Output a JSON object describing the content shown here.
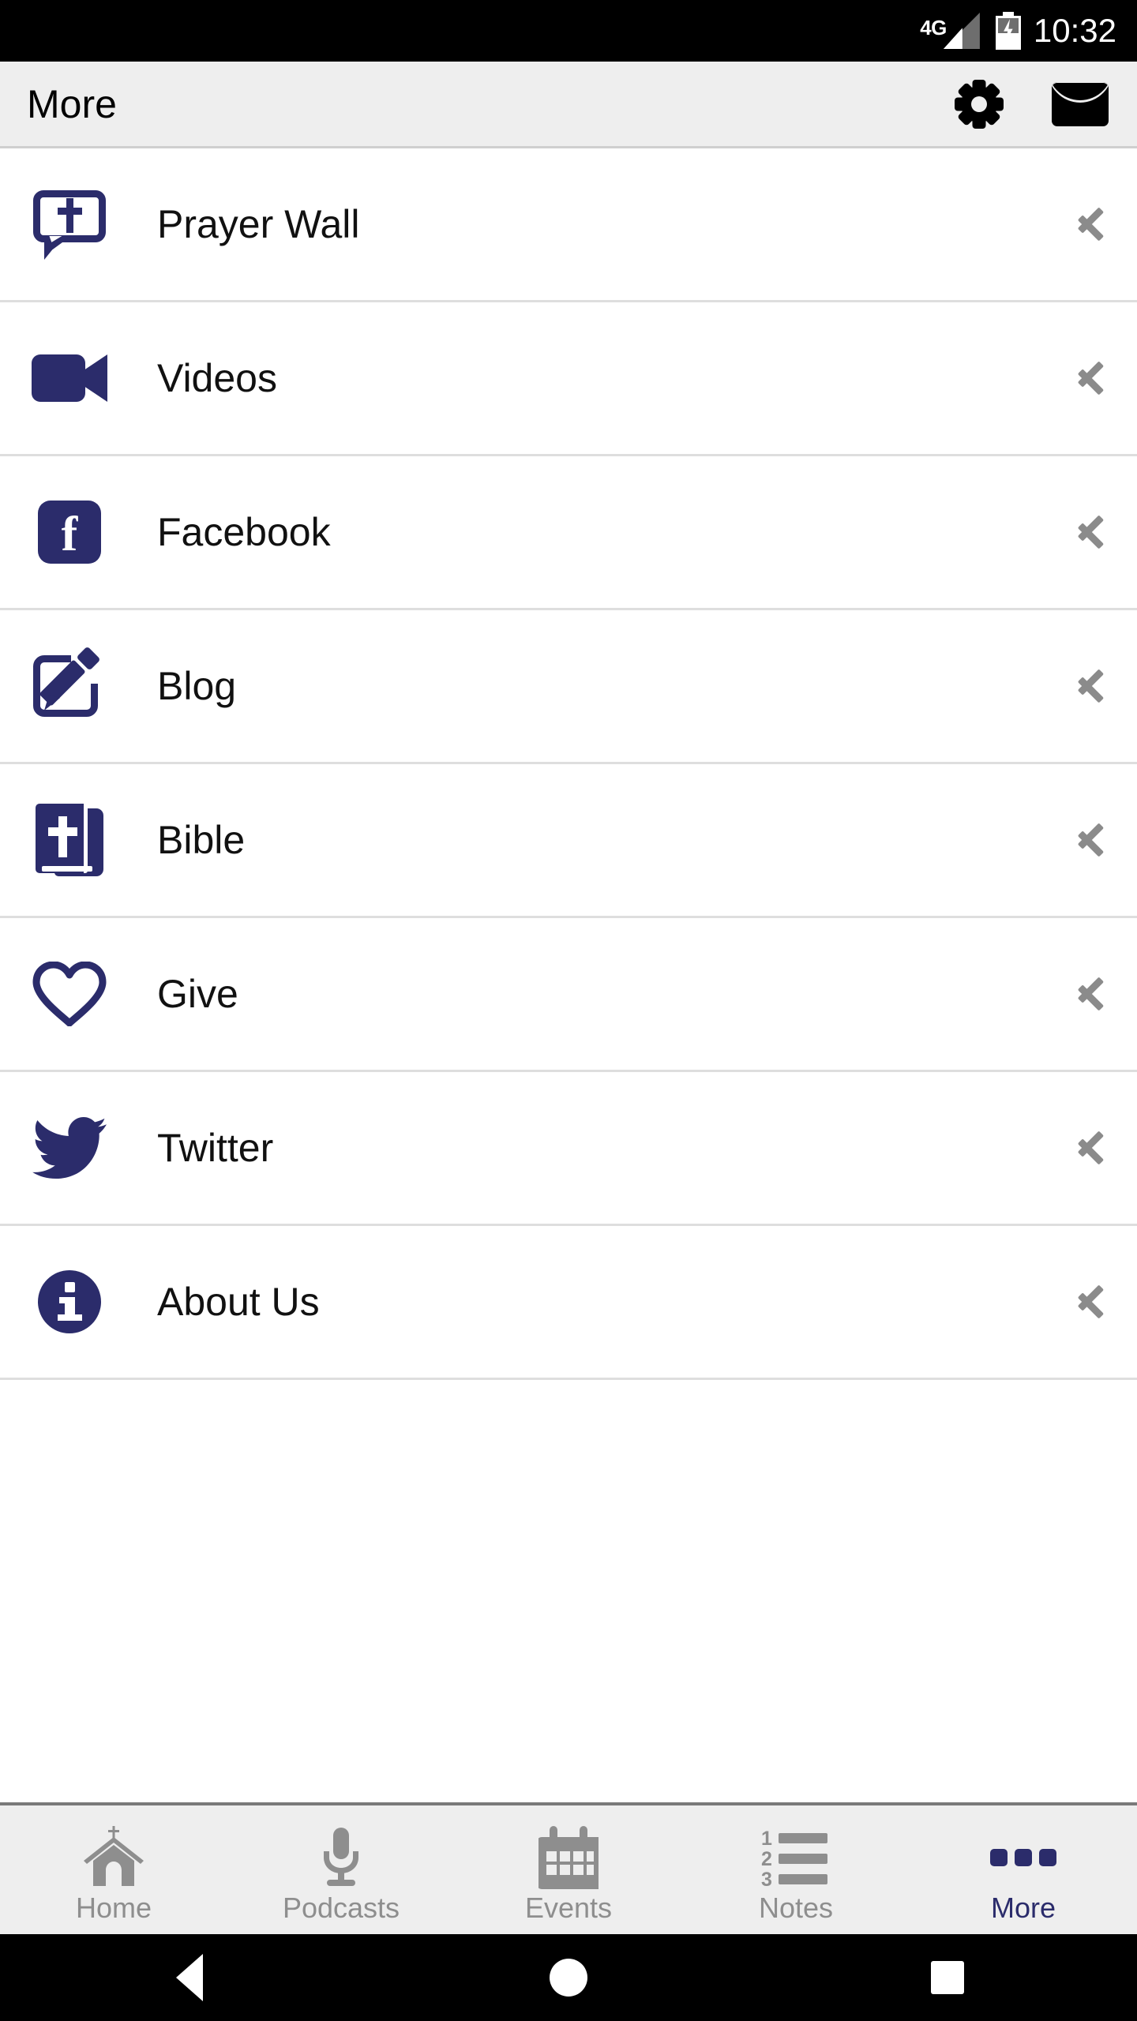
{
  "theme": {
    "navy": "#2b2c6b",
    "appbar_bg": "#eeeeee",
    "divider": "#dedede",
    "muted": "#8e8e8e"
  },
  "status_bar": {
    "network_label": "4G",
    "time": "10:32",
    "signal_icon": "signal-bars-icon",
    "battery_icon": "battery-charging-icon"
  },
  "app_bar": {
    "title": "More",
    "settings_icon": "gear-icon",
    "mail_icon": "envelope-icon"
  },
  "list": {
    "items": [
      {
        "label": "Prayer Wall",
        "icon": "prayer-bubble-cross-icon",
        "chevron": "chevron-right-icon"
      },
      {
        "label": "Videos",
        "icon": "video-camera-icon",
        "chevron": "chevron-right-icon"
      },
      {
        "label": "Facebook",
        "icon": "facebook-icon",
        "chevron": "chevron-right-icon",
        "glyph": "f"
      },
      {
        "label": "Blog",
        "icon": "pencil-square-icon",
        "chevron": "chevron-right-icon"
      },
      {
        "label": "Bible",
        "icon": "bible-book-cross-icon",
        "chevron": "chevron-right-icon"
      },
      {
        "label": "Give",
        "icon": "heart-outline-icon",
        "chevron": "chevron-right-icon"
      },
      {
        "label": "Twitter",
        "icon": "twitter-bird-icon",
        "chevron": "chevron-right-icon"
      },
      {
        "label": "About Us",
        "icon": "info-circle-icon",
        "chevron": "chevron-right-icon"
      }
    ]
  },
  "tab_bar": {
    "active": "More",
    "tabs": [
      {
        "label": "Home",
        "icon": "church-icon",
        "active": false
      },
      {
        "label": "Podcasts",
        "icon": "microphone-icon",
        "active": false
      },
      {
        "label": "Events",
        "icon": "calendar-icon",
        "active": false
      },
      {
        "label": "Notes",
        "icon": "numbered-list-icon",
        "active": false
      },
      {
        "label": "More",
        "icon": "three-dots-icon",
        "active": true
      }
    ]
  },
  "nav_bar": {
    "back_icon": "back-triangle-icon",
    "home_icon": "home-circle-icon",
    "recents_icon": "recents-square-icon"
  }
}
